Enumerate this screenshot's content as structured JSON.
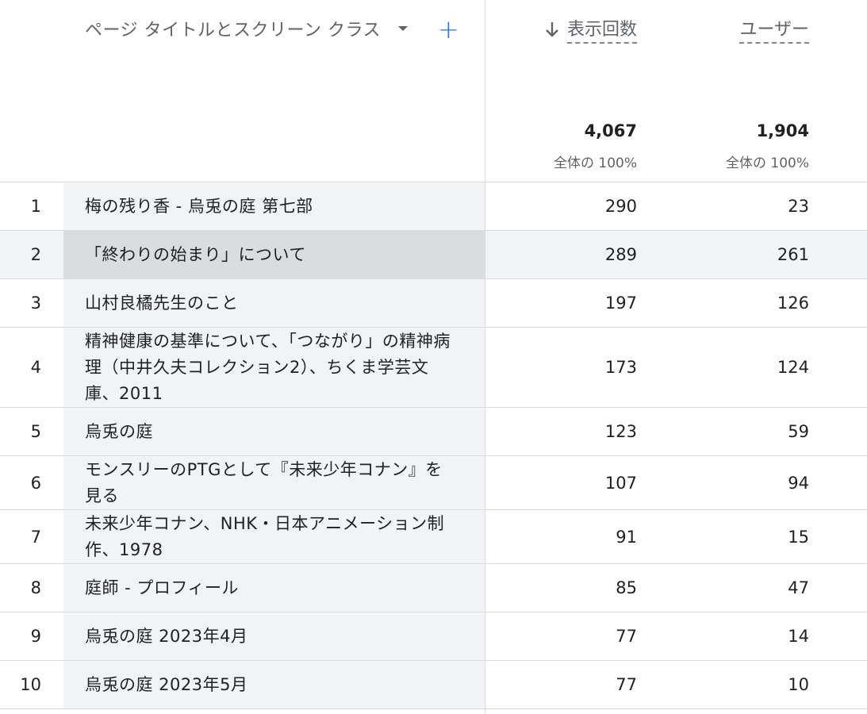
{
  "header": {
    "dimension_label": "ページ タイトルとスクリーン クラス",
    "add_label": "+",
    "views_label": "表示回数",
    "users_label": "ユーザー",
    "views_total": "4,067",
    "users_total": "1,904",
    "views_pct": "全体の 100%",
    "users_pct": "全体の 100%"
  },
  "rows": [
    {
      "index": "1",
      "title": "梅の残り香 - 烏兎の庭 第七部",
      "views": "290",
      "users": "23"
    },
    {
      "index": "2",
      "title": "「終わりの始まり」について",
      "views": "289",
      "users": "261"
    },
    {
      "index": "3",
      "title": "山村良橘先生のこと",
      "views": "197",
      "users": "126"
    },
    {
      "index": "4",
      "title": "精神健康の基準について、「つながり」の精神病理（中井久夫コレクション2）、ちくま学芸文庫、2011",
      "views": "173",
      "users": "124"
    },
    {
      "index": "5",
      "title": "烏兎の庭",
      "views": "123",
      "users": "59"
    },
    {
      "index": "6",
      "title": "モンスリーのPTGとして『未来少年コナン』を見る",
      "views": "107",
      "users": "94"
    },
    {
      "index": "7",
      "title": "未来少年コナン、NHK・日本アニメーション制作、1978",
      "views": "91",
      "users": "15"
    },
    {
      "index": "8",
      "title": "庭師 - プロフィール",
      "views": "85",
      "users": "47"
    },
    {
      "index": "9",
      "title": "烏兎の庭 2023年4月",
      "views": "77",
      "users": "14"
    },
    {
      "index": "10",
      "title": "烏兎の庭 2023年5月",
      "views": "77",
      "users": "10"
    }
  ]
}
